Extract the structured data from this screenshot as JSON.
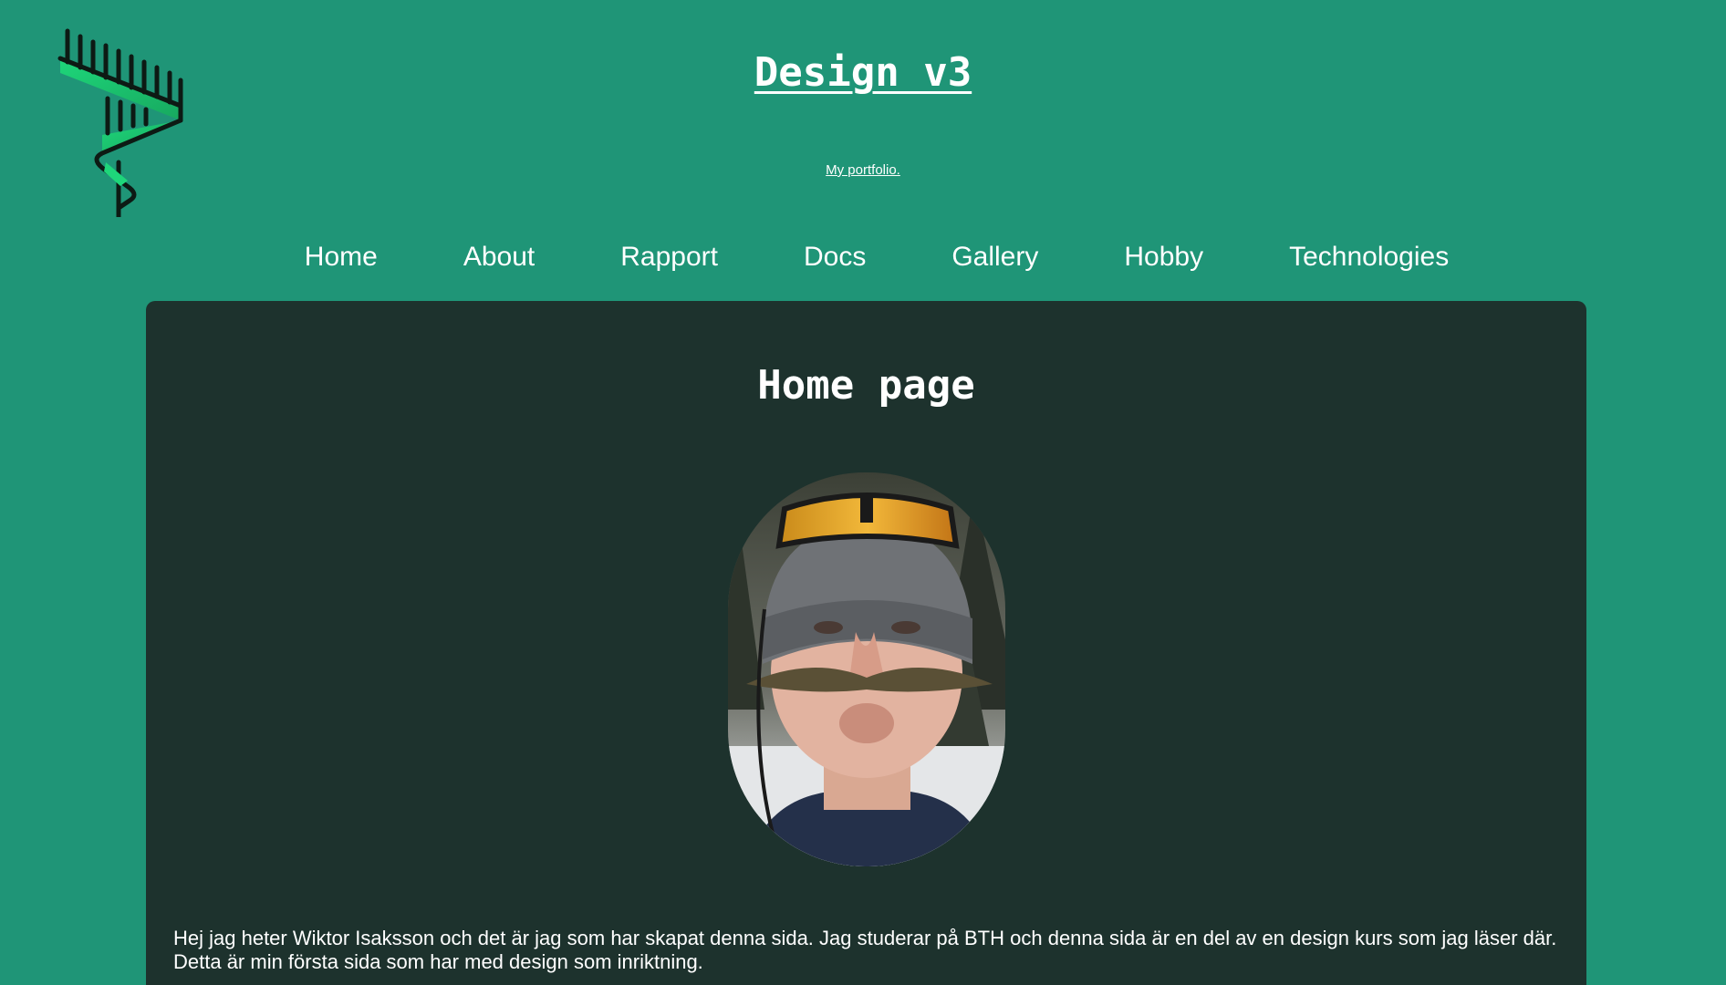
{
  "header": {
    "logo": "antler-logo-icon",
    "title": "Design v3",
    "tagline": "My portfolio."
  },
  "nav": {
    "items": [
      {
        "label": "Home"
      },
      {
        "label": "About"
      },
      {
        "label": "Rapport"
      },
      {
        "label": "Docs"
      },
      {
        "label": "Gallery"
      },
      {
        "label": "Hobby"
      },
      {
        "label": "Technologies"
      }
    ]
  },
  "main": {
    "heading": "Home page",
    "intro": "Hej jag heter Wiktor Isaksson och det är jag som har skapat denna sida. Jag studerar på BTH och denna sida är en del av en design kurs som jag läser där. Detta är min första sida som har med design som inriktning."
  },
  "colors": {
    "page_bg": "#1f9577",
    "content_bg": "#1d322d",
    "text": "#ffffff",
    "logo_green": "#22d17a"
  }
}
